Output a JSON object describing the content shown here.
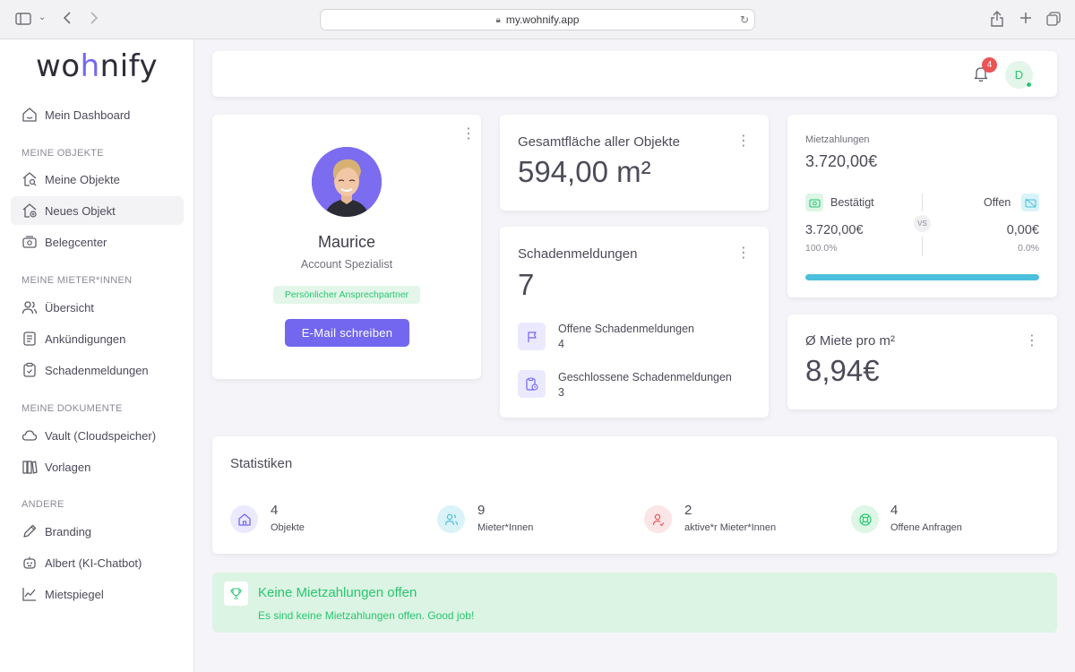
{
  "browser": {
    "url": "my.wohnify.app"
  },
  "logo": {
    "pre": "wo",
    "h": "h",
    "post": "nify"
  },
  "sidebar": {
    "dashboard": "Mein Dashboard",
    "section_objekte": "MEINE OBJEKTE",
    "objekte": "Meine Objekte",
    "neues_objekt": "Neues Objekt",
    "belegcenter": "Belegcenter",
    "section_mieter": "MEINE MIETER*INNEN",
    "uebersicht": "Übersicht",
    "ankuendigungen": "Ankündigungen",
    "schadenmeldungen": "Schadenmeldungen",
    "section_dokumente": "MEINE DOKUMENTE",
    "vault": "Vault (Cloudspeicher)",
    "vorlagen": "Vorlagen",
    "section_andere": "ANDERE",
    "branding": "Branding",
    "albert": "Albert (KI-Chatbot)",
    "mietspiegel": "Mietspiegel"
  },
  "topbar": {
    "notifications": "4",
    "avatar_initial": "D"
  },
  "profile": {
    "name": "Maurice",
    "role": "Account Spezialist",
    "tag": "Persönlicher Ansprechpartner",
    "button": "E-Mail schreiben"
  },
  "area": {
    "title": "Gesamtfläche aller Objekte",
    "value": "594,00 m²"
  },
  "damage": {
    "title": "Schadenmeldungen",
    "value": "7",
    "open_label": "Offene Schadenmeldungen",
    "open_value": "4",
    "closed_label": "Geschlossene Schadenmeldungen",
    "closed_value": "3"
  },
  "payments": {
    "label": "Mietzahlungen",
    "total": "3.720,00€",
    "confirmed_label": "Bestätigt",
    "open_label": "Offen",
    "vs": "VS",
    "confirmed_value": "3.720,00€",
    "confirmed_pct": "100.0%",
    "open_value": "0,00€",
    "open_pct": "0.0%",
    "progress_fraction": 1.0
  },
  "rent": {
    "title": "Ø Miete pro m²",
    "value": "8,94€"
  },
  "stats": {
    "title": "Statistiken",
    "items": [
      {
        "value": "4",
        "label": "Objekte"
      },
      {
        "value": "9",
        "label": "Mieter*Innen"
      },
      {
        "value": "2",
        "label": "aktive*r Mieter*Innen"
      },
      {
        "value": "4",
        "label": "Offene Anfragen"
      }
    ]
  },
  "alert": {
    "title": "Keine Mietzahlungen offen",
    "text": "Es sind keine Mietzahlungen offen. Good job!"
  },
  "colors": {
    "accent": "#7367f0",
    "success": "#28c76f",
    "info": "#4bc0de",
    "danger": "#ea5455"
  }
}
